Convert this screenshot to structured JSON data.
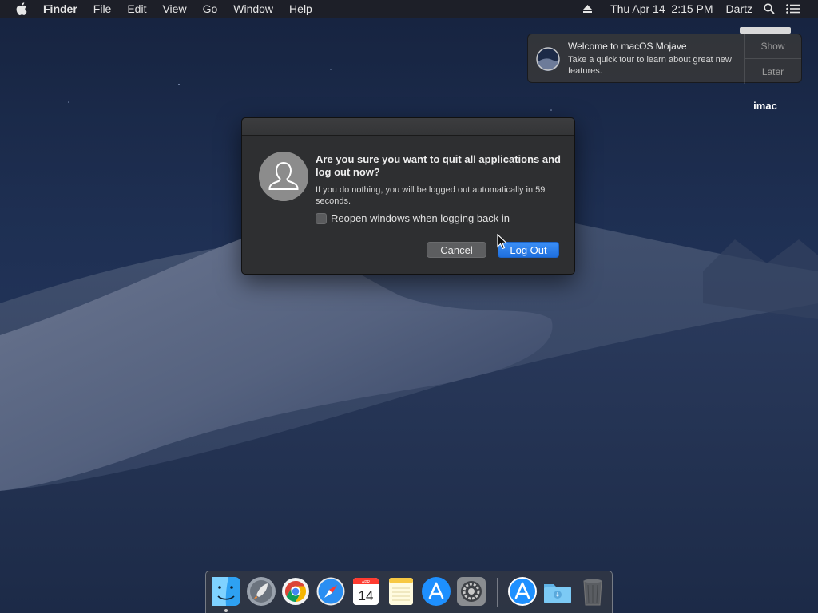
{
  "menubar": {
    "apple_icon": "apple-logo-icon",
    "app_name": "Finder",
    "items": [
      "File",
      "Edit",
      "View",
      "Go",
      "Window",
      "Help"
    ],
    "date_time": "Thu Apr 14  2:15 PM",
    "user": "Dartz",
    "icons": [
      "eject-icon",
      "search-icon",
      "notification-center-icon"
    ]
  },
  "notification": {
    "title": "Welcome to macOS Mojave",
    "body": "Take a quick tour to learn about great new features.",
    "show_label": "Show",
    "later_label": "Later"
  },
  "desktop": {
    "drive_label": "imac"
  },
  "dialog": {
    "title": "Are you sure you want to quit all applications and log out now?",
    "message": "If you do nothing, you will be logged out automatically in 59 seconds.",
    "checkbox_label": "Reopen windows when logging back in",
    "checkbox_checked": false,
    "cancel_label": "Cancel",
    "logout_label": "Log Out",
    "accent_color": "#2a7ae9"
  },
  "calendar_icon": {
    "month": "APR",
    "day": "14"
  },
  "dock": {
    "apps": [
      "finder",
      "launchpad",
      "chrome",
      "safari",
      "calendar",
      "notes",
      "app-store",
      "system-preferences",
      "app-store-downloads",
      "downloads-folder",
      "trash"
    ]
  }
}
